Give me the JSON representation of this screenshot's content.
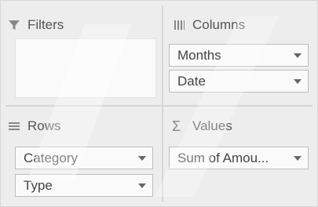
{
  "filters": {
    "title": "Filters",
    "icon": "funnel-icon"
  },
  "columns": {
    "title": "Columns",
    "icon": "columns-icon",
    "fields": [
      "Months",
      "Date"
    ]
  },
  "rows": {
    "title": "Rows",
    "icon": "rows-icon",
    "fields": [
      "Category",
      "Type"
    ]
  },
  "values": {
    "title": "Values",
    "icon": "sigma-icon",
    "fields": [
      "Sum of Amou..."
    ]
  },
  "colors": {
    "background": "#ededed",
    "field_bg": "#fafafa",
    "border": "#bdbdbd",
    "divider": "#d6d6d6"
  }
}
